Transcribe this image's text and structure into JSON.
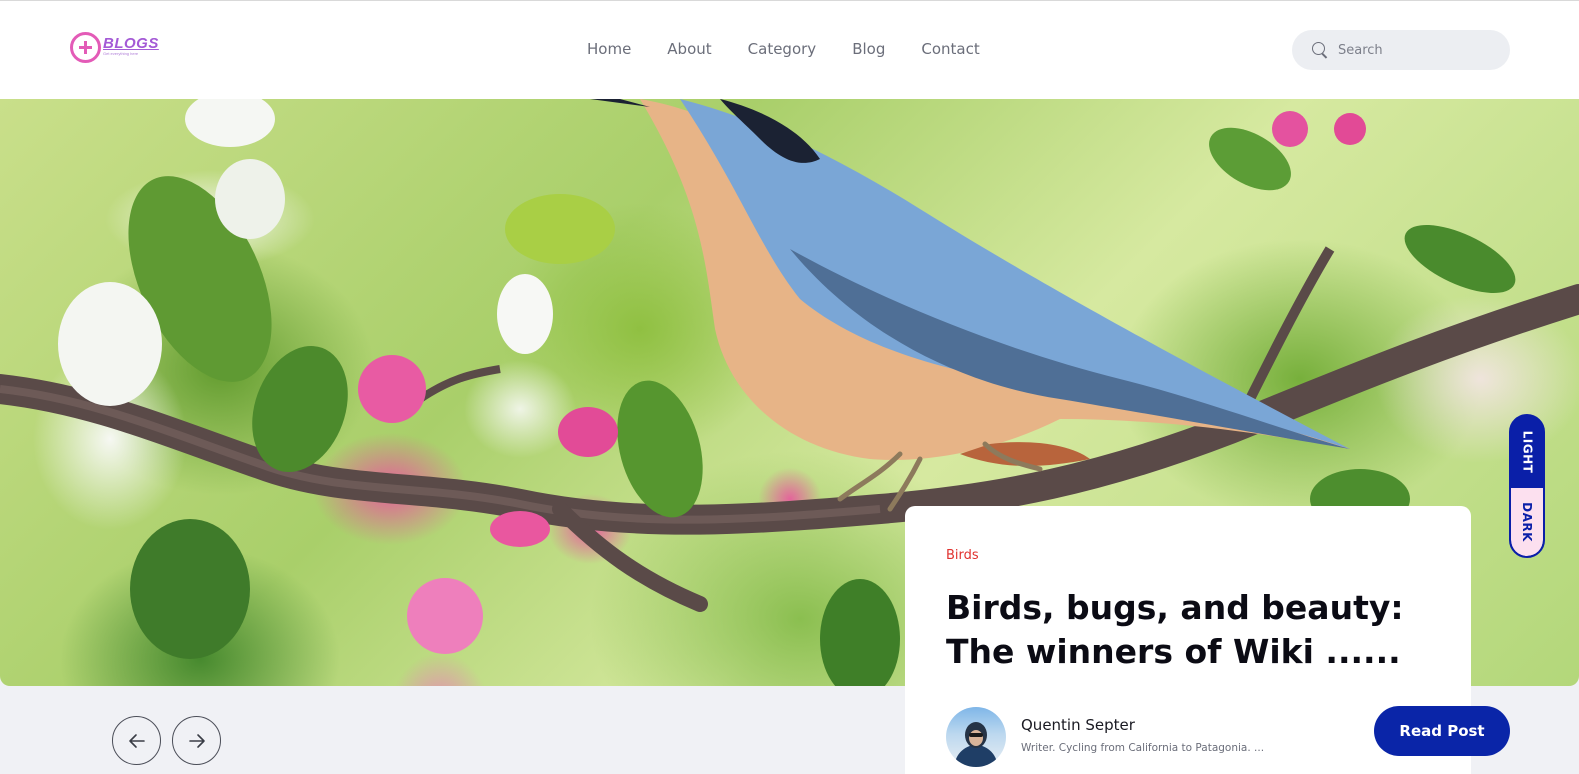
{
  "brand": {
    "name": "BLOGS",
    "tagline": "Get everything here"
  },
  "nav": {
    "items": [
      {
        "label": "Home"
      },
      {
        "label": "About"
      },
      {
        "label": "Category"
      },
      {
        "label": "Blog"
      },
      {
        "label": "Contact"
      }
    ]
  },
  "search": {
    "placeholder": "Search",
    "icon": "search-icon"
  },
  "theme_toggle": {
    "light_label": "LIGHT",
    "dark_label": "DARK",
    "active": "light"
  },
  "featured_post": {
    "category": "Birds",
    "title": "Birds, bugs, and beauty: The winners of Wiki ......",
    "author_name": "Quentin Septer",
    "author_bio": "Writer. Cycling from California to Patagonia. ...",
    "read_button_label": "Read Post"
  },
  "slider": {
    "prev_icon": "arrow-left-icon",
    "next_icon": "arrow-right-icon"
  },
  "colors": {
    "accent": "#0a25a8",
    "brand_pink": "#e35bb7",
    "brand_purple": "#a45ad6",
    "category_red": "#e0322f",
    "page_bg": "#f0f1f5"
  }
}
